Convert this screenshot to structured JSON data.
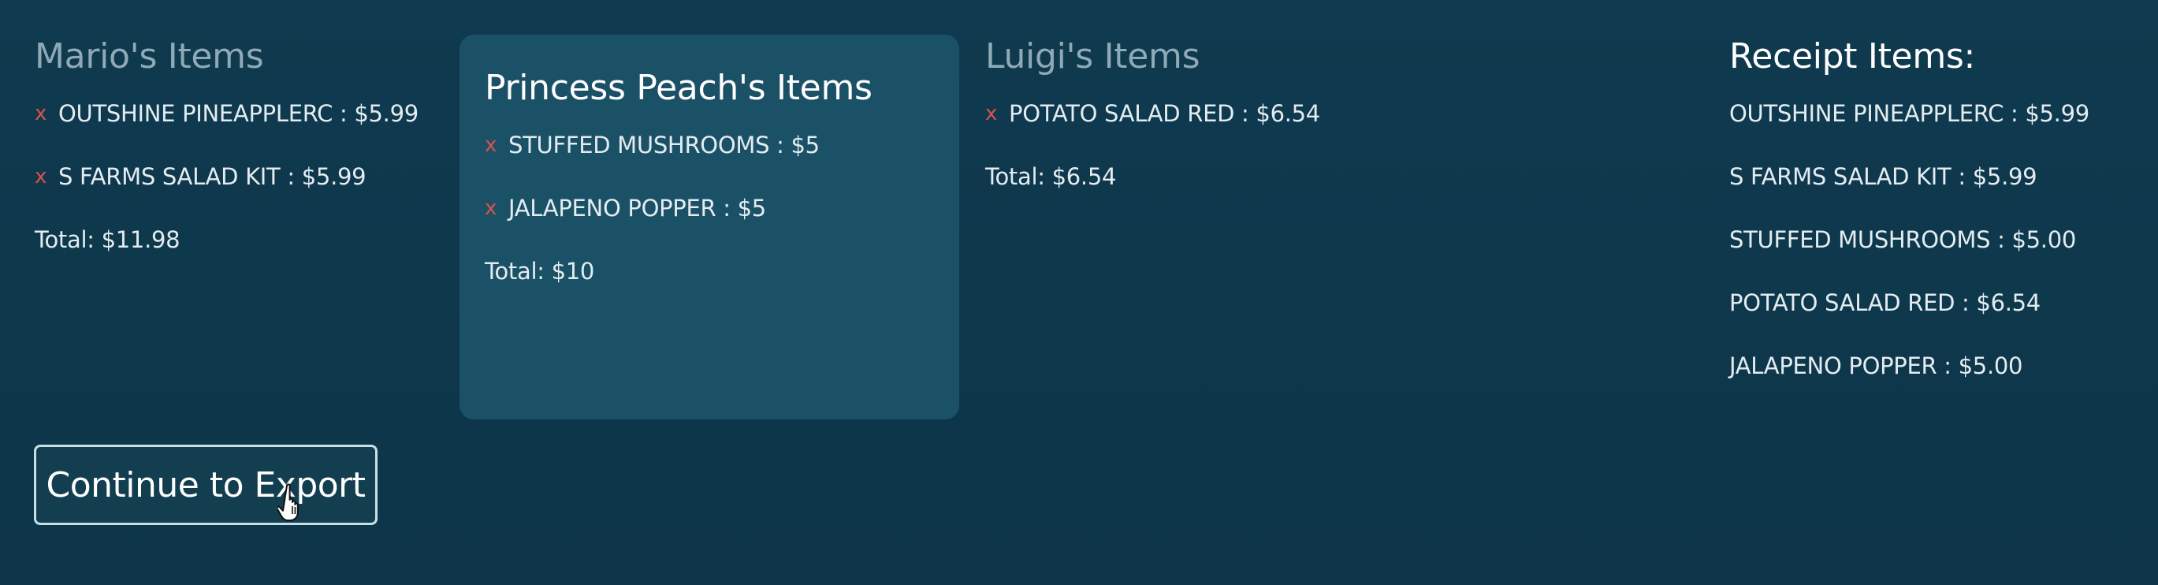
{
  "mario": {
    "title": "Mario's Items",
    "items": [
      {
        "remove": "x",
        "label": "OUTSHINE PINEAPPLERC : $5.99"
      },
      {
        "remove": "x",
        "label": "S FARMS SALAD KIT : $5.99"
      }
    ],
    "total": "Total: $11.98"
  },
  "peach": {
    "title": "Princess Peach's Items",
    "items": [
      {
        "remove": "x",
        "label": "STUFFED MUSHROOMS : $5"
      },
      {
        "remove": "x",
        "label": "JALAPENO POPPER : $5"
      }
    ],
    "total": "Total: $10"
  },
  "luigi": {
    "title": "Luigi's Items",
    "items": [
      {
        "remove": "x",
        "label": "POTATO SALAD RED : $6.54"
      }
    ],
    "total": "Total: $6.54"
  },
  "receipt": {
    "title": "Receipt Items:",
    "items": [
      "OUTSHINE PINEAPPLERC : $5.99",
      "S FARMS SALAD KIT : $5.99",
      "STUFFED MUSHROOMS : $5.00",
      "POTATO SALAD RED : $6.54",
      "JALAPENO POPPER : $5.00"
    ]
  },
  "actions": {
    "continue_label": "Continue to Export"
  },
  "colors": {
    "background": "#0f3a4f",
    "active_panel": "#1b5167",
    "remove_x": "#d9534f",
    "muted_heading": "#8fa9b7"
  },
  "icons": {
    "cursor": "hand-pointer-icon"
  }
}
